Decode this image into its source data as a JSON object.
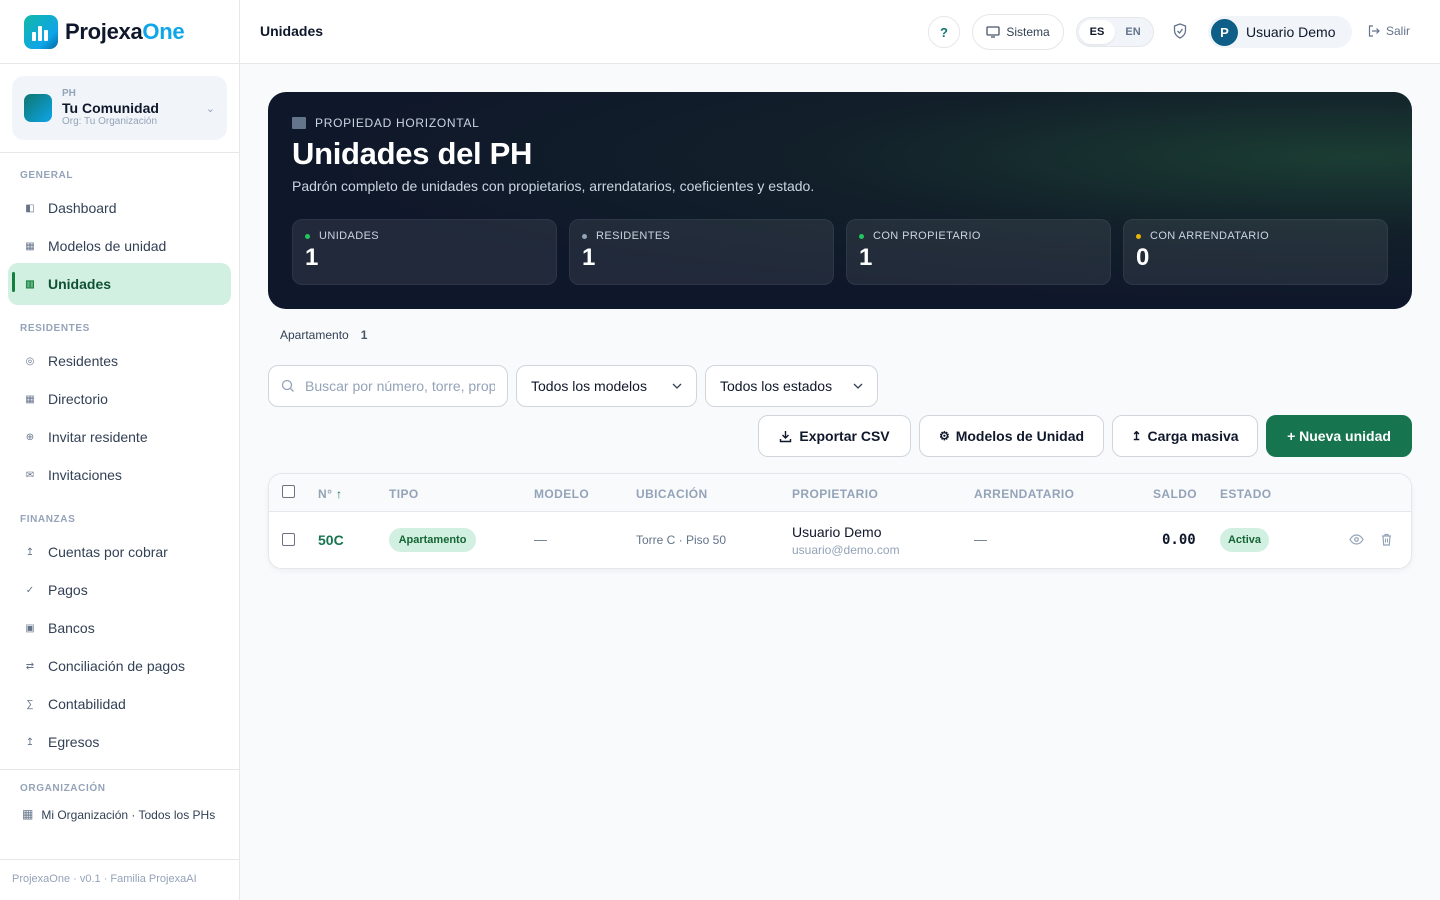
{
  "brand": {
    "name_a": "Projexa",
    "name_b": "One",
    "accent": "#0ea5e9"
  },
  "org": {
    "kind": "PH",
    "name": "Tu Comunidad",
    "sub": "Org: Tu Organización"
  },
  "sidebar": {
    "sections": [
      {
        "title": "GENERAL"
      },
      {
        "title": "RESIDENTES"
      },
      {
        "title": "FINANZAS"
      },
      {
        "title": "ORGANIZACIÓN"
      }
    ],
    "items": [
      {
        "label": "Dashboard",
        "icon": "dashboard-icon",
        "glyph": "◧"
      },
      {
        "label": "Modelos de unidad",
        "icon": "grid-icon",
        "glyph": "▦"
      },
      {
        "label": "Unidades",
        "icon": "building-icon",
        "glyph": "▥",
        "active": true
      },
      {
        "label": "Residentes",
        "icon": "people-icon",
        "glyph": "◎"
      },
      {
        "label": "Directorio",
        "icon": "directory-icon",
        "glyph": "▦"
      },
      {
        "label": "Invitar residente",
        "icon": "invite-icon",
        "glyph": "⊕"
      },
      {
        "label": "Invitaciones",
        "icon": "mail-icon",
        "glyph": "✉"
      },
      {
        "label": "Cuentas por cobrar",
        "icon": "receivable-icon",
        "glyph": "↥"
      },
      {
        "label": "Pagos",
        "icon": "check-icon",
        "glyph": "✓"
      },
      {
        "label": "Bancos",
        "icon": "bank-icon",
        "glyph": "▣"
      },
      {
        "label": "Conciliación de pagos",
        "icon": "swap-icon",
        "glyph": "⇄"
      },
      {
        "label": "Contabilidad",
        "icon": "sigma-icon",
        "glyph": "∑"
      },
      {
        "label": "Egresos",
        "icon": "expense-icon",
        "glyph": "↥"
      }
    ],
    "org_item": "Mi Organización · Todos los PHs",
    "footer": "ProjexaOne · v0.1 · Familia ProjexaAI"
  },
  "topbar": {
    "title": "Unidades",
    "help": "?",
    "system": "Sistema",
    "lang": [
      "ES",
      "EN"
    ],
    "user_initial": "P",
    "user_name": "Usuario Demo",
    "logout": "Salir"
  },
  "hero": {
    "kicker": "PROPIEDAD HORIZONTAL",
    "title": "Unidades del PH",
    "subtitle": "Padrón completo de unidades con propietarios, arrendatarios, coeficientes y estado.",
    "stats": [
      {
        "label": "UNIDADES",
        "value": "1",
        "dot": "#22c55e"
      },
      {
        "label": "RESIDENTES",
        "value": "1",
        "dot": "#94a3b8"
      },
      {
        "label": "CON PROPIETARIO",
        "value": "1",
        "dot": "#22c55e"
      },
      {
        "label": "CON ARRENDATARIO",
        "value": "0",
        "dot": "#eab308"
      }
    ]
  },
  "filters": {
    "chip_label": "Apartamento",
    "chip_count": "1",
    "search_placeholder": "Buscar por número, torre, propietario...",
    "model_select": "Todos los modelos",
    "state_select": "Todos los estados"
  },
  "actions": {
    "export": "Exportar CSV",
    "models": "Modelos de Unidad",
    "bulk": "Carga masiva",
    "new": "+ Nueva unidad"
  },
  "table": {
    "headers": [
      "N°",
      "TIPO",
      "MODELO",
      "UBICACIÓN",
      "PROPIETARIO",
      "ARRENDATARIO",
      "SALDO",
      "ESTADO"
    ],
    "sort_glyph": "↑",
    "rows": [
      {
        "number": "50C",
        "type": "Apartamento",
        "model": "—",
        "location": "Torre C · Piso 50",
        "owner_name": "Usuario Demo",
        "owner_email": "usuario@demo.com",
        "tenant": "—",
        "balance": "0.00",
        "state": "Activa"
      }
    ]
  }
}
